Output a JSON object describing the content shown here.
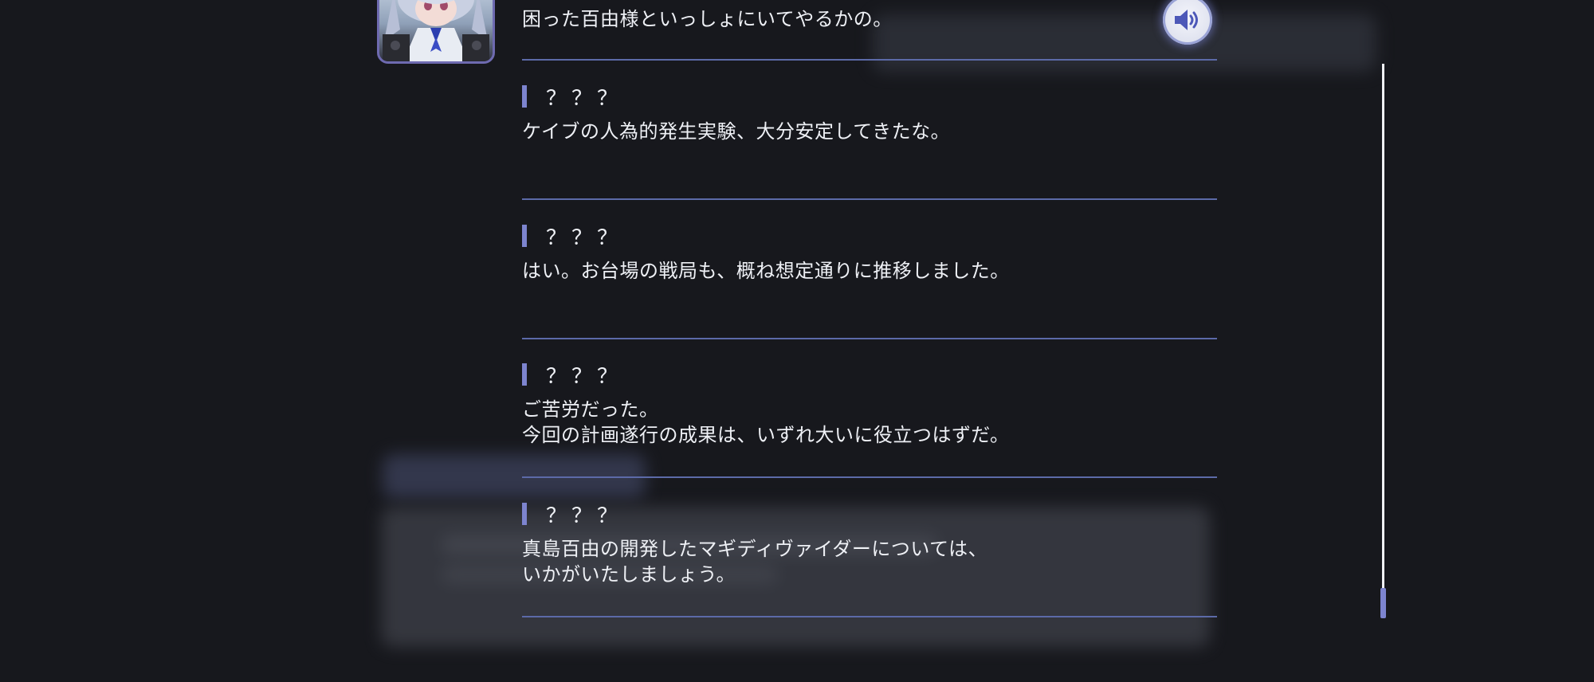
{
  "backlog": {
    "first_line": "困った百由様といっしょにいてやるかの。",
    "entries": [
      {
        "speaker": "？？？",
        "lines": [
          "ケイブの人為的発生実験、大分安定してきたな。"
        ]
      },
      {
        "speaker": "？？？",
        "lines": [
          "はい。お台場の戦局も、概ね想定通りに推移しました。"
        ]
      },
      {
        "speaker": "？？？",
        "lines": [
          "ご苦労だった。",
          "今回の計画遂行の成果は、いずれ大いに役立つはずだ。"
        ]
      },
      {
        "speaker": "？？？",
        "lines": [
          "真島百由の開発したマギディヴァイダーについては、",
          "いかがいたしましょう。"
        ]
      }
    ]
  },
  "icons": {
    "voice": "speaker-icon",
    "portrait": "character-portrait"
  },
  "colors": {
    "background": "#17181d",
    "accent": "#7d84cf",
    "divider": "#5c6aa8",
    "text": "#eef0f5"
  }
}
